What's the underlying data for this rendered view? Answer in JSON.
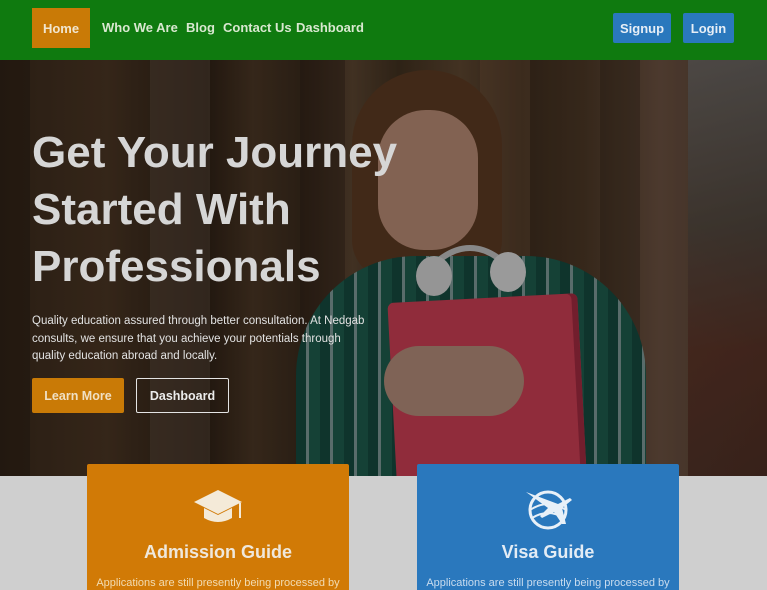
{
  "nav": {
    "home": "Home",
    "links": [
      "Who We Are",
      "Blog",
      "Contact Us",
      "Dashboard"
    ],
    "signup": "Signup",
    "login": "Login"
  },
  "hero": {
    "title_lines": [
      "Get Your Journey",
      "Started With",
      "Professionals"
    ],
    "subtitle": "Quality education assured through better consultation. At Nedgab consults, we ensure that you achieve your potentials through quality education abroad and locally.",
    "learn_more": "Learn More",
    "dashboard": "Dashboard"
  },
  "cards": [
    {
      "icon": "graduation-cap-icon",
      "title": "Admission Guide",
      "text": "Applications are still presently being processed by"
    },
    {
      "icon": "airplane-globe-icon",
      "title": "Visa Guide",
      "text": "Applications are still presently being processed by"
    }
  ],
  "colors": {
    "nav_bg": "#0f7a0f",
    "accent_orange": "#c97a06",
    "accent_blue": "#2a78bd"
  }
}
